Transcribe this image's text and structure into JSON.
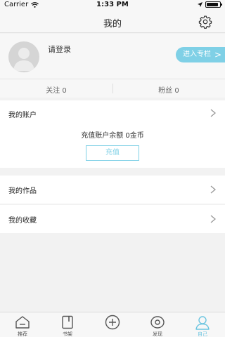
{
  "status_bar": {
    "carrier": "Carrier",
    "time": "1:33 PM",
    "battery_level": 0.9
  },
  "nav": {
    "title": "我的",
    "settings_icon": "gear-icon"
  },
  "profile": {
    "login_prompt": "请登录",
    "enter_column_label": "进入专栏",
    "enter_chevron": ">"
  },
  "stats": {
    "following": "关注 0",
    "fans": "粉丝 0"
  },
  "account": {
    "title": "我的账户",
    "balance_text": "充值账户余额 0金币",
    "recharge_label": "充值"
  },
  "menu": {
    "works": "我的作品",
    "favorites": "我的收藏"
  },
  "tabs": [
    {
      "label": "推荐",
      "icon": "home-icon"
    },
    {
      "label": "书架",
      "icon": "bookshelf-icon"
    },
    {
      "label": "",
      "icon": "plus-circle-icon"
    },
    {
      "label": "发现",
      "icon": "discover-icon"
    },
    {
      "label": "自己",
      "icon": "user-icon"
    }
  ],
  "colors": {
    "accent": "#7fd0e6",
    "active_tab": "#6cc5e0"
  }
}
